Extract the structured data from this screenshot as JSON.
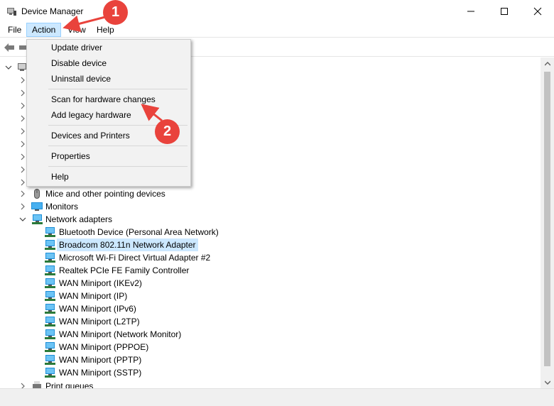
{
  "window": {
    "title": "Device Manager"
  },
  "menubar": {
    "file": "File",
    "action": "Action",
    "view": "View",
    "help": "Help"
  },
  "action_menu": {
    "group1": [
      "Update driver",
      "Disable device",
      "Uninstall device"
    ],
    "group2": [
      "Scan for hardware changes",
      "Add legacy hardware"
    ],
    "group3": [
      "Devices and Printers"
    ],
    "group4": [
      "Properties"
    ],
    "group5": [
      "Help"
    ]
  },
  "tree": {
    "categories": [
      {
        "label": "Mice and other pointing devices",
        "icon": "mouse-icon"
      },
      {
        "label": "Monitors",
        "icon": "monitor-icon"
      },
      {
        "label": "Network adapters",
        "icon": "network-adapter-icon"
      }
    ],
    "network_adapters": [
      "Bluetooth Device (Personal Area Network)",
      "Broadcom 802.11n Network Adapter",
      "Microsoft Wi-Fi Direct Virtual Adapter #2",
      "Realtek PCIe FE Family Controller",
      "WAN Miniport (IKEv2)",
      "WAN Miniport (IP)",
      "WAN Miniport (IPv6)",
      "WAN Miniport (L2TP)",
      "WAN Miniport (Network Monitor)",
      "WAN Miniport (PPPOE)",
      "WAN Miniport (PPTP)",
      "WAN Miniport (SSTP)"
    ],
    "print_queues": "Print queues"
  },
  "annotations": {
    "step1": "1",
    "step2": "2"
  },
  "colors": {
    "selection": "#cce8ff",
    "annotation": "#e9433c",
    "menu_bg": "#f2f2f2",
    "adapter_icon": "#1e8ed6"
  }
}
